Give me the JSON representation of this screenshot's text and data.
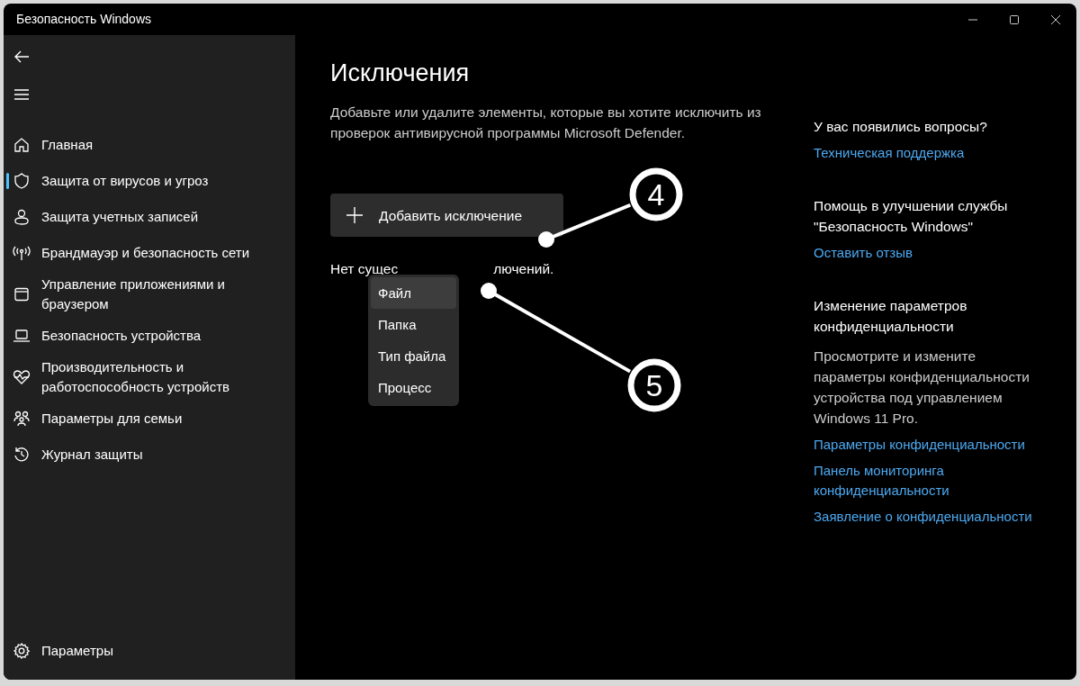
{
  "window": {
    "title": "Безопасность Windows"
  },
  "sidebar": {
    "items": [
      {
        "label": "Главная",
        "selected": false
      },
      {
        "label": "Защита от вирусов и угроз",
        "selected": true
      },
      {
        "label": "Защита учетных записей",
        "selected": false
      },
      {
        "label": "Брандмауэр и безопасность сети",
        "selected": false
      },
      {
        "label": "Управление приложениями и браузером",
        "selected": false
      },
      {
        "label": "Безопасность устройства",
        "selected": false
      },
      {
        "label": "Производительность и работоспособность устройств",
        "selected": false
      },
      {
        "label": "Параметры для семьи",
        "selected": false
      },
      {
        "label": "Журнал защиты",
        "selected": false
      }
    ],
    "footer": {
      "label": "Параметры"
    }
  },
  "main": {
    "title": "Исключения",
    "description": "Добавьте или удалите элементы, которые вы хотите исключить из проверок антивирусной программы Microsoft Defender.",
    "add_button": "Добавить исключение",
    "status_text_parts": [
      "Нет сущес",
      "лючений."
    ],
    "menu": [
      {
        "label": "Файл",
        "selected": true
      },
      {
        "label": "Папка",
        "selected": false
      },
      {
        "label": "Тип файла",
        "selected": false
      },
      {
        "label": "Процесс",
        "selected": false
      }
    ]
  },
  "aside": [
    {
      "heading": "У вас появились вопросы?",
      "links": [
        "Техническая поддержка"
      ]
    },
    {
      "heading": "Помощь в улучшении службы \"Безопасность Windows\"",
      "links": [
        "Оставить отзыв"
      ]
    },
    {
      "heading": "Изменение параметров конфиденциальности",
      "text": "Просмотрите и измените параметры конфиденциальности устройства под управлением Windows 11 Pro.",
      "links": [
        "Параметры конфиденциальности",
        "Панель мониторинга конфиденциальности",
        "Заявление о конфиденциальности"
      ]
    }
  ],
  "annotations": [
    {
      "label": "4"
    },
    {
      "label": "5"
    }
  ]
}
